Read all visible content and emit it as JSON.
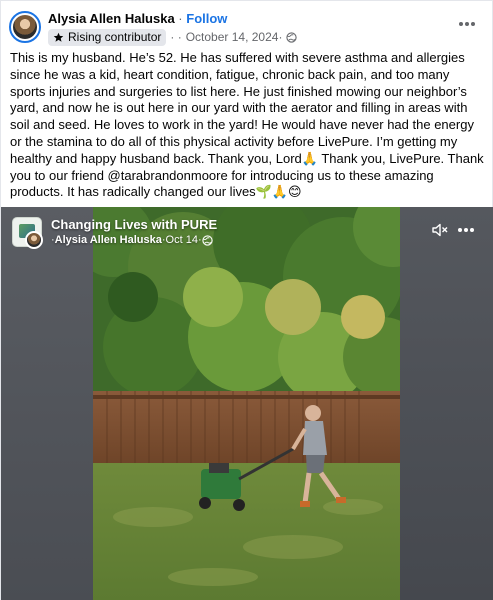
{
  "post": {
    "author": "Alysia Allen Haluska",
    "separator": " · ",
    "follow_label": "Follow",
    "badge_label": "Rising contributor",
    "date_prefix": "· · ",
    "date": "October 14, 2024",
    "date_suffix": " · ",
    "text": "This is my husband. He’s 52. He has suffered with severe asthma and allergies since he was a kid, heart condition, fatigue, chronic back pain, and too many sports injuries and surgeries to list here. He just finished mowing our neighbor’s yard, and now he is out here in our yard with the aerator and filling in areas with soil and seed. He loves to work in the yard! He would have never had the energy or the stamina to do all of this physical activity before LivePure. I’m getting my healthy and happy husband back. Thank you, Lord🙏 Thank you, LivePure. Thank you to our friend @tarabrandonmoore for introducing us to these amazing products. It has radically changed our lives🌱🙏😊"
  },
  "video": {
    "channel_title": "Changing Lives with PURE",
    "sub_prefix": "· ",
    "sub_author": "Alysia Allen Haluska",
    "sub_sep": " · ",
    "sub_date": "Oct 14",
    "sub_suffix": " · "
  },
  "icons": {
    "star": "star-icon",
    "globe": "globe-icon",
    "more": "more-icon",
    "mute": "volume-muted-icon"
  },
  "colors": {
    "accent": "#1b74e4",
    "secondary_text": "#65676b",
    "badge_bg": "#e4e6eb"
  }
}
